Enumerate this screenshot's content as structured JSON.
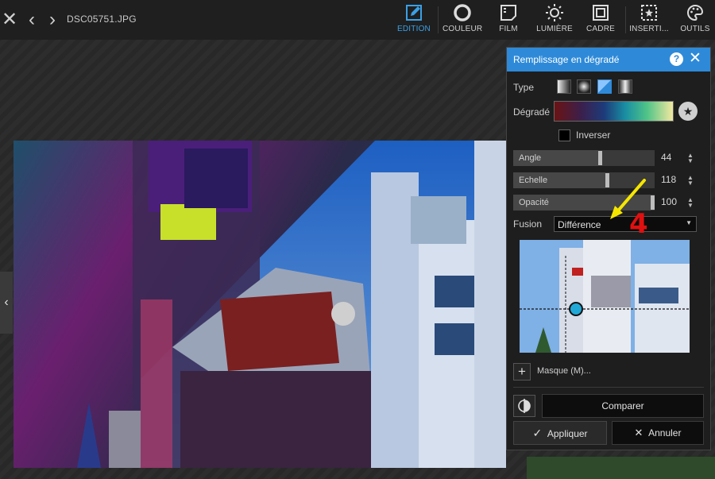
{
  "header": {
    "filename": "DSC05751.JPG",
    "tools": [
      {
        "label": "EDITION",
        "icon": "edit-icon"
      },
      {
        "label": "COULEUR",
        "icon": "color-icon"
      },
      {
        "label": "FILM",
        "icon": "film-icon"
      },
      {
        "label": "LUMIÈRE",
        "icon": "sun-icon"
      },
      {
        "label": "CADRE",
        "icon": "frame-icon"
      },
      {
        "label": "INSERTI...",
        "icon": "insert-icon"
      },
      {
        "label": "OUTILS",
        "icon": "palette-icon"
      }
    ],
    "active_tool": "EDITION"
  },
  "panel": {
    "title": "Remplissage en dégradé",
    "type_label": "Type",
    "gradient_label": "Dégradé",
    "invert_label": "Inverser",
    "sliders": [
      {
        "name": "Angle",
        "value": 44,
        "fraction": 0.62
      },
      {
        "name": "Echelle",
        "value": 118,
        "fraction": 0.67
      },
      {
        "name": "Opacité",
        "value": 100,
        "fraction": 1.0
      }
    ],
    "fusion_label": "Fusion",
    "fusion_value": "Différence",
    "mask_label": "Masque (M)...",
    "compare_label": "Comparer",
    "apply_label": "Appliquer",
    "cancel_label": "Annuler"
  },
  "annotation": {
    "number": "4"
  },
  "colors": {
    "accent": "#2e8ad8",
    "active_tool": "#3aa0e6",
    "annotation_arrow": "#f5e600",
    "annotation_number": "#e01010"
  }
}
